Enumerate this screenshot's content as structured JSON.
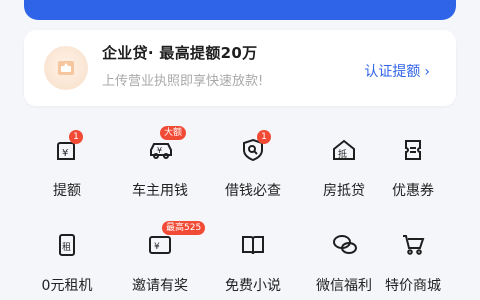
{
  "loan_card": {
    "title": "企业贷· 最高提额20万",
    "subtitle": "上传营业执照即享快速放款!",
    "action": "认证提额",
    "action_chevron": "›",
    "icon": "business-license-icon"
  },
  "row1": [
    {
      "label": "提额",
      "icon": "yuan-arrow-icon",
      "badge": "1"
    },
    {
      "label": "车主用钱",
      "icon": "car-yuan-icon",
      "badge": "大额"
    },
    {
      "label": "借钱必查",
      "icon": "shield-search-icon",
      "badge": "1"
    },
    {
      "label": "房抵贷",
      "icon": "house-icon",
      "badge": ""
    },
    {
      "label": "优惠券",
      "icon": "coupon-icon",
      "badge": ""
    }
  ],
  "row2": [
    {
      "label": "0元租机",
      "icon": "phone-rent-icon",
      "badge": ""
    },
    {
      "label": "邀请有奖",
      "icon": "invite-envelope-icon",
      "badge": "最高525"
    },
    {
      "label": "免费小说",
      "icon": "book-icon",
      "badge": ""
    },
    {
      "label": "微信福利",
      "icon": "wechat-icon",
      "badge": ""
    },
    {
      "label": "特价商城",
      "icon": "cart-icon",
      "badge": ""
    }
  ],
  "glyphs": {
    "yuan": "¥",
    "house_char": "抵",
    "phone_char": "租"
  },
  "colors": {
    "accent": "#2f63e8",
    "badge": "#f14b35",
    "icon_stroke": "#1f1f1f"
  }
}
